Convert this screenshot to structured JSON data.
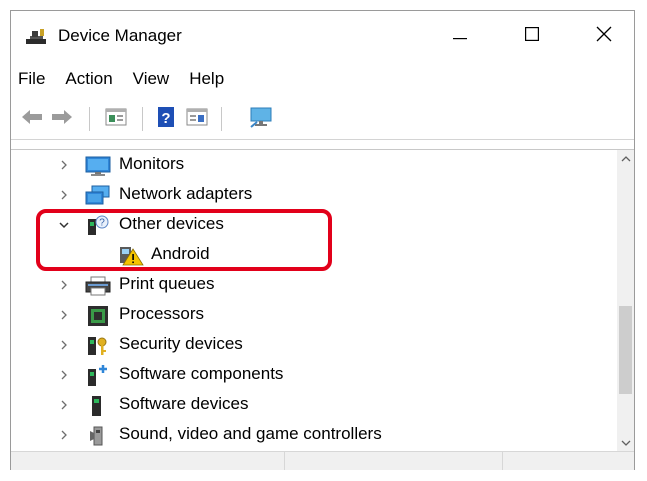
{
  "window": {
    "title": "Device Manager",
    "icons": {
      "app": "device-manager-icon",
      "minimize": "minimize-icon",
      "maximize": "maximize-icon",
      "close": "close-icon"
    }
  },
  "menu": {
    "items": [
      {
        "label": "File"
      },
      {
        "label": "Action"
      },
      {
        "label": "View"
      },
      {
        "label": "Help"
      }
    ]
  },
  "toolbar": {
    "buttons": [
      {
        "icon": "back-arrow-icon"
      },
      {
        "icon": "forward-arrow-icon"
      },
      {
        "icon": "properties-icon"
      },
      {
        "icon": "help-icon"
      },
      {
        "icon": "show-hide-console-tree-icon"
      },
      {
        "icon": "scan-for-hardware-changes-icon"
      }
    ]
  },
  "tree": {
    "items": [
      {
        "label": "Monitors",
        "state": "collapsed",
        "icon": "monitor-icon"
      },
      {
        "label": "Network adapters",
        "state": "collapsed",
        "icon": "network-adapter-icon"
      },
      {
        "label": "Other devices",
        "state": "expanded",
        "icon": "unknown-device-icon"
      },
      {
        "label": "Android",
        "state": "leaf",
        "icon": "warning-device-icon"
      },
      {
        "label": "Print queues",
        "state": "collapsed",
        "icon": "printer-icon"
      },
      {
        "label": "Processors",
        "state": "collapsed",
        "icon": "processor-icon"
      },
      {
        "label": "Security devices",
        "state": "collapsed",
        "icon": "security-key-icon"
      },
      {
        "label": "Software components",
        "state": "collapsed",
        "icon": "software-component-icon"
      },
      {
        "label": "Software devices",
        "state": "collapsed",
        "icon": "software-device-icon"
      },
      {
        "label": "Sound, video and game controllers",
        "state": "collapsed",
        "icon": "speaker-icon"
      }
    ]
  },
  "colors": {
    "highlight": "#e2001a",
    "chevron": "#6e6e6e",
    "warning": "#f5c400"
  }
}
